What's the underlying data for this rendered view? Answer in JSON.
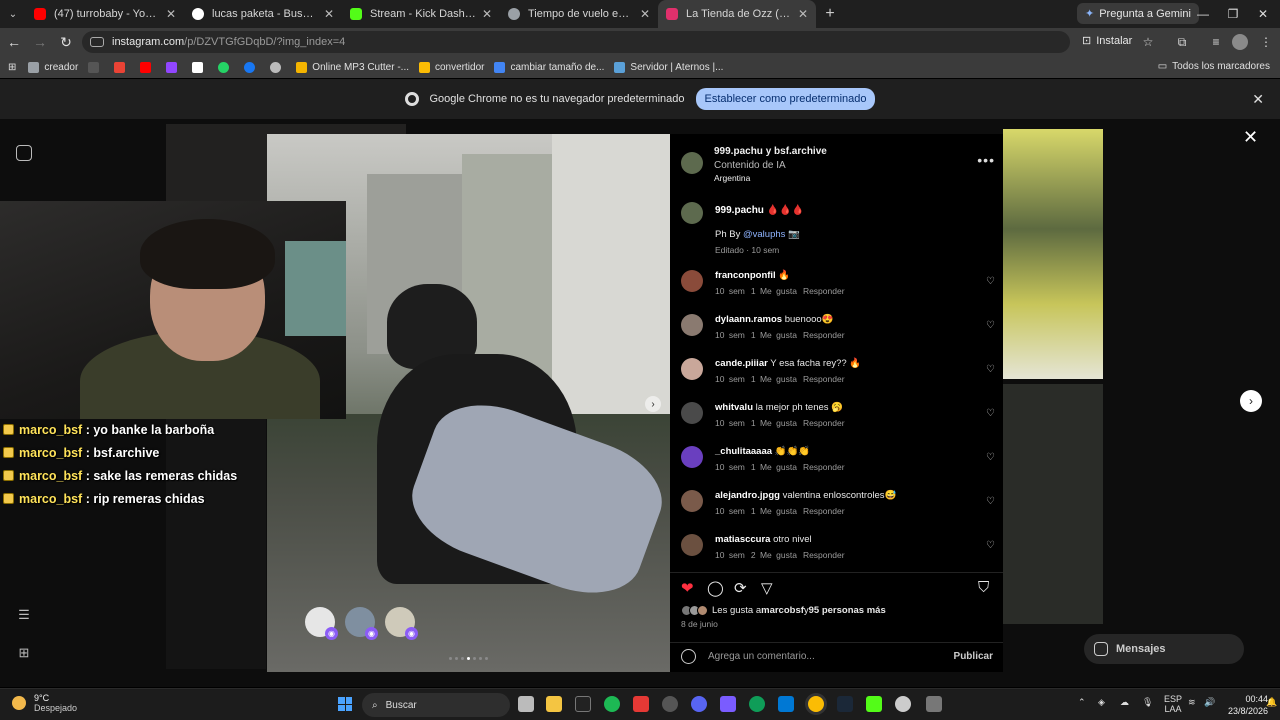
{
  "browser": {
    "tabs": [
      {
        "title": "(47) turrobaby - YouTube",
        "color": "#ff0000"
      },
      {
        "title": "lucas paketa - Buscar con Google",
        "color": "#ffffff"
      },
      {
        "title": "Stream - Kick Dashboard",
        "color": "#53fc18"
      },
      {
        "title": "Tiempo de vuelo en F-16",
        "color": "#9aa0a6"
      },
      {
        "title": "La Tienda de Ozz (@latiendadeozz)",
        "color": "#e1306c",
        "active": true
      }
    ],
    "new_tab": "+",
    "gemini_label": "Pregunta a Gemini",
    "url_host": "instagram.com",
    "url_path": "/p/DZVTGfGDqbD/?img_index=4",
    "install_label": "Instalar",
    "bookmarks": [
      {
        "label": "creador",
        "color": "#9aa0a6"
      },
      {
        "label": "",
        "color": "#2b2b2b"
      },
      {
        "label": "",
        "color": "#ea4335"
      },
      {
        "label": "",
        "color": "#ff0000"
      },
      {
        "label": "",
        "color": "#9146ff"
      },
      {
        "label": "",
        "color": "#ffffff"
      },
      {
        "label": "",
        "color": "#25d366"
      },
      {
        "label": "",
        "color": "#1877f2"
      },
      {
        "label": "",
        "color": "#bbbbbb"
      },
      {
        "label": "Online MP3 Cutter -...",
        "color": "#f4b400"
      },
      {
        "label": "convertidor",
        "color": "#fbbc04"
      },
      {
        "label": "cambiar tamaño de...",
        "color": "#4285f4"
      },
      {
        "label": "Servidor | Aternos |...",
        "color": "#5aa0d8"
      }
    ],
    "all_bookmarks": "Todos los marcadores",
    "infobar_text": "Google Chrome no es tu navegador predeterminado",
    "infobar_button": "Establecer como predeterminado"
  },
  "stream_chat": [
    {
      "user": "marco_bsf",
      "message": ": yo banke la barboña"
    },
    {
      "user": "marco_bsf",
      "message": ": bsf.archive"
    },
    {
      "user": "marco_bsf",
      "message": ": sake las remeras chidas"
    },
    {
      "user": "marco_bsf",
      "message": ": rip remeras chidas"
    }
  ],
  "post": {
    "header_names": "999.pachu y bsf.archive",
    "header_sub": "Contenido de IA",
    "header_location": "Argentina",
    "caption_user": "999.pachu",
    "caption_emoji": "🩸🩸🩸",
    "caption_ph_prefix": "Ph By ",
    "caption_mention": "@valuphs",
    "caption_camera": "📷",
    "caption_meta": "Editado · 10 sem",
    "comments": [
      {
        "user": "franconponfil",
        "text": "🔥",
        "age": "10 sem",
        "likes": "1 Me gusta",
        "reply": "Responder",
        "color": "#8a4b3a"
      },
      {
        "user": "dylaann.ramos",
        "text": "buenooo😍",
        "age": "10 sem",
        "likes": "1 Me gusta",
        "reply": "Responder",
        "color": "#8a7a70"
      },
      {
        "user": "cande.piiiar",
        "text": "Y esa facha rey?? 🔥",
        "age": "10 sem",
        "likes": "1 Me gusta",
        "reply": "Responder",
        "color": "#c9a79a"
      },
      {
        "user": "whitvalu",
        "text": "la mejor ph tenes 🥱",
        "age": "10 sem",
        "likes": "1 Me gusta",
        "reply": "Responder",
        "color": "#4a4a4a"
      },
      {
        "user": "_chulitaaaaa",
        "text": "👏👏👏",
        "age": "10 sem",
        "likes": "1 Me gusta",
        "reply": "Responder",
        "color": "#6a3fbf"
      },
      {
        "user": "alejandro.jpgg",
        "text": "valentina enloscontroles😅",
        "age": "10 sem",
        "likes": "1 Me gusta",
        "reply": "Responder",
        "color": "#7a5a4a"
      },
      {
        "user": "matiasccura",
        "text": "otro nivel",
        "age": "10 sem",
        "likes": "2 Me gusta",
        "reply": "Responder",
        "color": "#6b5040"
      }
    ],
    "likes_prefix": "Les gusta a ",
    "likes_user": "marcobsf",
    "likes_middle": " y ",
    "likes_count": "95 personas más",
    "date": "8 de junio",
    "comment_placeholder": "Agrega un comentario...",
    "publish": "Publicar",
    "carousel_total": 7,
    "carousel_index": 4
  },
  "messages_label": "Mensajes",
  "taskbar": {
    "temp": "9°C",
    "weather": "Despejado",
    "search": "Buscar",
    "lang1": "ESP",
    "lang2": "LAA",
    "time": "00:44",
    "date": "23/8/2026"
  }
}
